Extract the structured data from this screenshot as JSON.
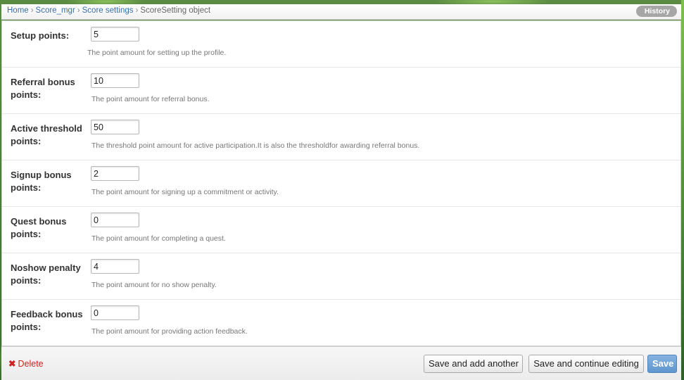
{
  "breadcrumbs": {
    "home": "Home",
    "score_mgr": "Score_mgr",
    "score_settings": "Score settings",
    "current": "ScoreSetting object",
    "separator": "›"
  },
  "history_label": "History",
  "fields": [
    {
      "label": "Setup points:",
      "value": "5",
      "help": "The point amount for setting up the profile."
    },
    {
      "label": "Referral bonus points:",
      "value": "10",
      "help": "The point amount for referral bonus."
    },
    {
      "label": "Active threshold points:",
      "value": "50",
      "help": "The threshold point amount for active participation.It is also the thresholdfor awarding referral bonus."
    },
    {
      "label": "Signup bonus points:",
      "value": "2",
      "help": "The point amount for signing up a commitment or activity."
    },
    {
      "label": "Quest bonus points:",
      "value": "0",
      "help": "The point amount for completing a quest."
    },
    {
      "label": "Noshow penalty points:",
      "value": "4",
      "help": "The point amount for no show penalty."
    },
    {
      "label": "Feedback bonus points:",
      "value": "0",
      "help": "The point amount for providing action feedback."
    }
  ],
  "actions": {
    "delete_label": "Delete",
    "delete_icon": "✖",
    "save_add_label": "Save and add another",
    "save_continue_label": "Save and continue editing",
    "save_label": "Save"
  },
  "colors": {
    "link": "#3a6fa8",
    "delete": "#cc2222",
    "save_button": "#6a9fd6"
  }
}
